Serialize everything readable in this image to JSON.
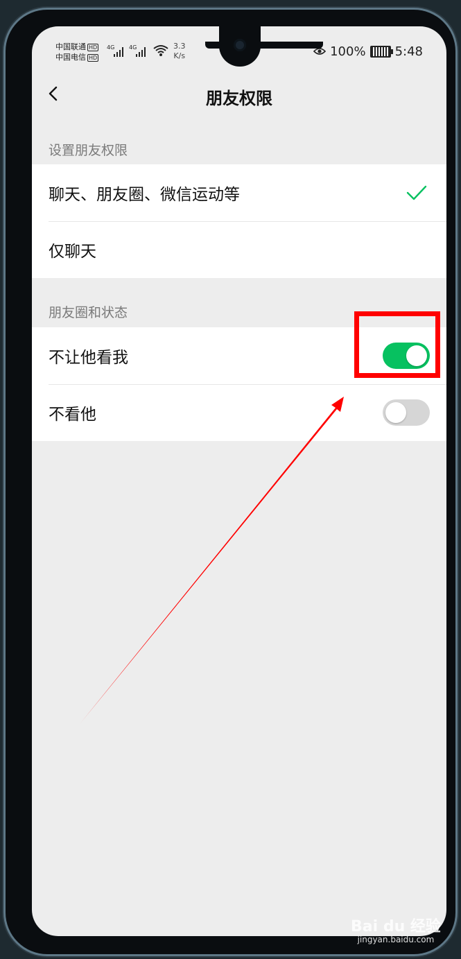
{
  "status_bar": {
    "carrier1": "中国联通",
    "carrier2": "中国电信",
    "hd_badge": "HD",
    "sig1_label": "4G",
    "sig2_label": "4G",
    "net_speed_value": "3.3",
    "net_speed_unit": "K/s",
    "battery_percent": "100%",
    "time": "5:48"
  },
  "nav": {
    "title": "朋友权限",
    "back_icon": "chevron-left-icon"
  },
  "section_permissions": {
    "header": "设置朋友权限",
    "options": [
      {
        "label": "聊天、朋友圈、微信运动等",
        "selected": true
      },
      {
        "label": "仅聊天",
        "selected": false
      }
    ]
  },
  "section_moments": {
    "header": "朋友圈和状态",
    "toggles": [
      {
        "label": "不让他看我",
        "on": true
      },
      {
        "label": "不看他",
        "on": false
      }
    ]
  },
  "colors": {
    "accent_green": "#07c160",
    "annotation_red": "#ff0000",
    "background": "#ededed"
  },
  "watermark": {
    "logo": "Bai du 经验",
    "url": "jingyan.baidu.com"
  }
}
